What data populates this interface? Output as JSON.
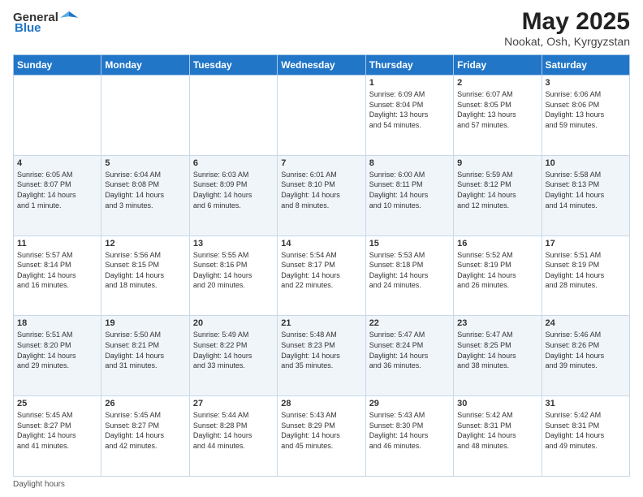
{
  "logo": {
    "general": "General",
    "blue": "Blue"
  },
  "title": "May 2025",
  "subtitle": "Nookat, Osh, Kyrgyzstan",
  "days_of_week": [
    "Sunday",
    "Monday",
    "Tuesday",
    "Wednesday",
    "Thursday",
    "Friday",
    "Saturday"
  ],
  "footer": "Daylight hours",
  "weeks": [
    [
      {
        "day": "",
        "info": ""
      },
      {
        "day": "",
        "info": ""
      },
      {
        "day": "",
        "info": ""
      },
      {
        "day": "",
        "info": ""
      },
      {
        "day": "1",
        "info": "Sunrise: 6:09 AM\nSunset: 8:04 PM\nDaylight: 13 hours\nand 54 minutes."
      },
      {
        "day": "2",
        "info": "Sunrise: 6:07 AM\nSunset: 8:05 PM\nDaylight: 13 hours\nand 57 minutes."
      },
      {
        "day": "3",
        "info": "Sunrise: 6:06 AM\nSunset: 8:06 PM\nDaylight: 13 hours\nand 59 minutes."
      }
    ],
    [
      {
        "day": "4",
        "info": "Sunrise: 6:05 AM\nSunset: 8:07 PM\nDaylight: 14 hours\nand 1 minute."
      },
      {
        "day": "5",
        "info": "Sunrise: 6:04 AM\nSunset: 8:08 PM\nDaylight: 14 hours\nand 3 minutes."
      },
      {
        "day": "6",
        "info": "Sunrise: 6:03 AM\nSunset: 8:09 PM\nDaylight: 14 hours\nand 6 minutes."
      },
      {
        "day": "7",
        "info": "Sunrise: 6:01 AM\nSunset: 8:10 PM\nDaylight: 14 hours\nand 8 minutes."
      },
      {
        "day": "8",
        "info": "Sunrise: 6:00 AM\nSunset: 8:11 PM\nDaylight: 14 hours\nand 10 minutes."
      },
      {
        "day": "9",
        "info": "Sunrise: 5:59 AM\nSunset: 8:12 PM\nDaylight: 14 hours\nand 12 minutes."
      },
      {
        "day": "10",
        "info": "Sunrise: 5:58 AM\nSunset: 8:13 PM\nDaylight: 14 hours\nand 14 minutes."
      }
    ],
    [
      {
        "day": "11",
        "info": "Sunrise: 5:57 AM\nSunset: 8:14 PM\nDaylight: 14 hours\nand 16 minutes."
      },
      {
        "day": "12",
        "info": "Sunrise: 5:56 AM\nSunset: 8:15 PM\nDaylight: 14 hours\nand 18 minutes."
      },
      {
        "day": "13",
        "info": "Sunrise: 5:55 AM\nSunset: 8:16 PM\nDaylight: 14 hours\nand 20 minutes."
      },
      {
        "day": "14",
        "info": "Sunrise: 5:54 AM\nSunset: 8:17 PM\nDaylight: 14 hours\nand 22 minutes."
      },
      {
        "day": "15",
        "info": "Sunrise: 5:53 AM\nSunset: 8:18 PM\nDaylight: 14 hours\nand 24 minutes."
      },
      {
        "day": "16",
        "info": "Sunrise: 5:52 AM\nSunset: 8:19 PM\nDaylight: 14 hours\nand 26 minutes."
      },
      {
        "day": "17",
        "info": "Sunrise: 5:51 AM\nSunset: 8:19 PM\nDaylight: 14 hours\nand 28 minutes."
      }
    ],
    [
      {
        "day": "18",
        "info": "Sunrise: 5:51 AM\nSunset: 8:20 PM\nDaylight: 14 hours\nand 29 minutes."
      },
      {
        "day": "19",
        "info": "Sunrise: 5:50 AM\nSunset: 8:21 PM\nDaylight: 14 hours\nand 31 minutes."
      },
      {
        "day": "20",
        "info": "Sunrise: 5:49 AM\nSunset: 8:22 PM\nDaylight: 14 hours\nand 33 minutes."
      },
      {
        "day": "21",
        "info": "Sunrise: 5:48 AM\nSunset: 8:23 PM\nDaylight: 14 hours\nand 35 minutes."
      },
      {
        "day": "22",
        "info": "Sunrise: 5:47 AM\nSunset: 8:24 PM\nDaylight: 14 hours\nand 36 minutes."
      },
      {
        "day": "23",
        "info": "Sunrise: 5:47 AM\nSunset: 8:25 PM\nDaylight: 14 hours\nand 38 minutes."
      },
      {
        "day": "24",
        "info": "Sunrise: 5:46 AM\nSunset: 8:26 PM\nDaylight: 14 hours\nand 39 minutes."
      }
    ],
    [
      {
        "day": "25",
        "info": "Sunrise: 5:45 AM\nSunset: 8:27 PM\nDaylight: 14 hours\nand 41 minutes."
      },
      {
        "day": "26",
        "info": "Sunrise: 5:45 AM\nSunset: 8:27 PM\nDaylight: 14 hours\nand 42 minutes."
      },
      {
        "day": "27",
        "info": "Sunrise: 5:44 AM\nSunset: 8:28 PM\nDaylight: 14 hours\nand 44 minutes."
      },
      {
        "day": "28",
        "info": "Sunrise: 5:43 AM\nSunset: 8:29 PM\nDaylight: 14 hours\nand 45 minutes."
      },
      {
        "day": "29",
        "info": "Sunrise: 5:43 AM\nSunset: 8:30 PM\nDaylight: 14 hours\nand 46 minutes."
      },
      {
        "day": "30",
        "info": "Sunrise: 5:42 AM\nSunset: 8:31 PM\nDaylight: 14 hours\nand 48 minutes."
      },
      {
        "day": "31",
        "info": "Sunrise: 5:42 AM\nSunset: 8:31 PM\nDaylight: 14 hours\nand 49 minutes."
      }
    ]
  ]
}
